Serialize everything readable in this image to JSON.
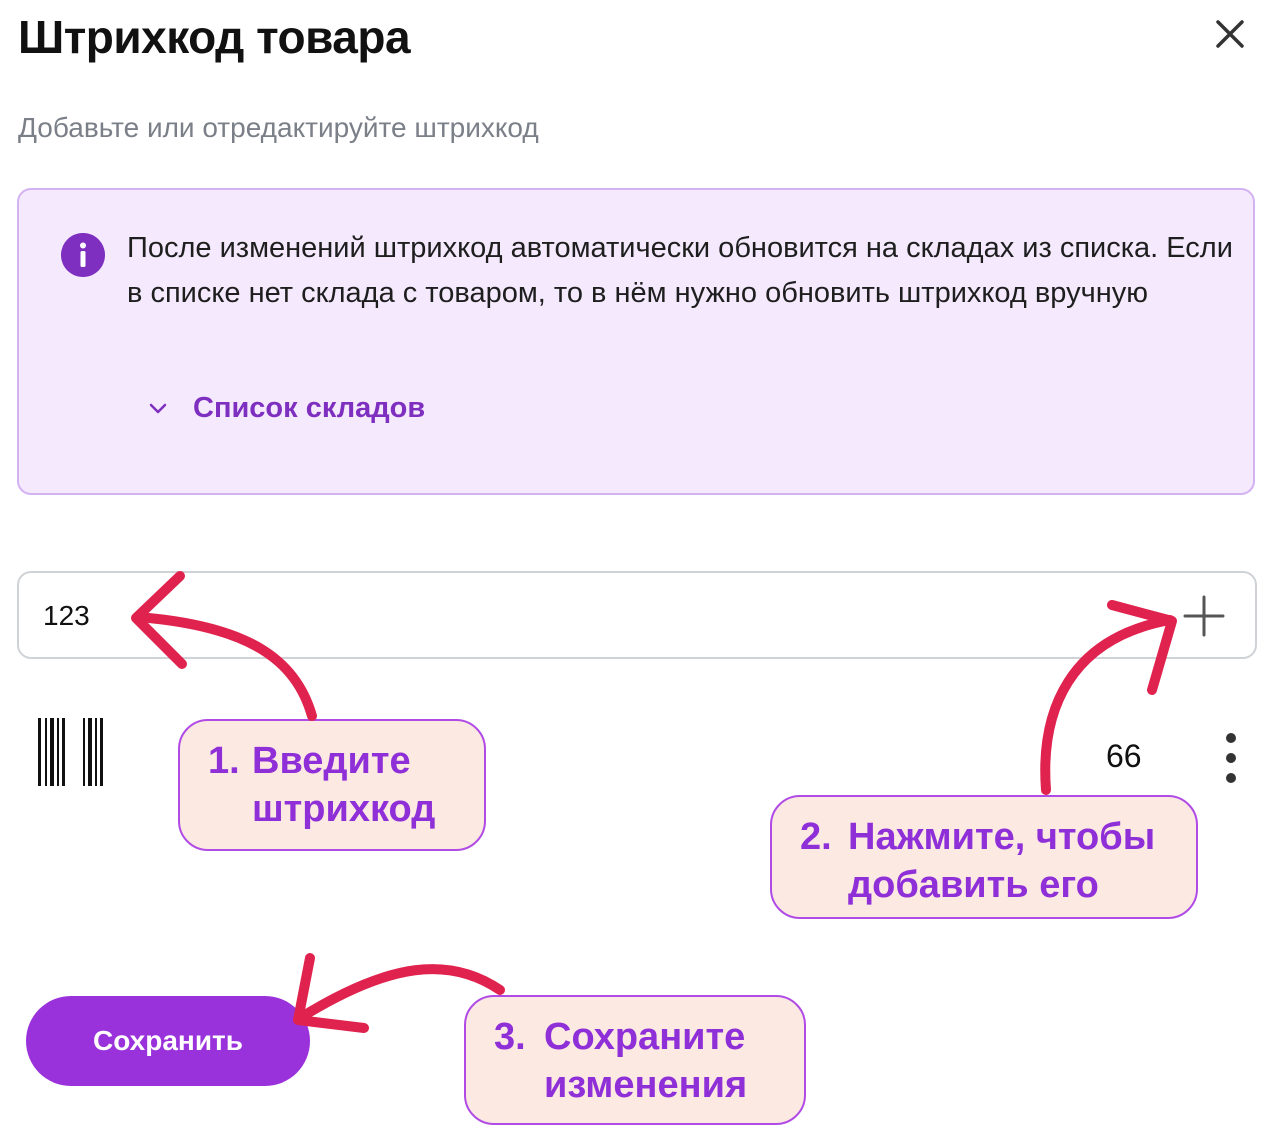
{
  "dialog": {
    "title": "Штрихкод товара",
    "subtitle": "Добавьте или отредактируйте штрихкод",
    "close_icon": "close-icon"
  },
  "info_banner": {
    "icon": "info-icon",
    "text": "После изменений штрихкод автоматически обновится на складах из списка. Если в списке нет склада с товаром, то в нём нужно обновить штрихкод вручную",
    "warehouses_toggle_label": "Список складов",
    "toggle_icon": "chevron-down-icon"
  },
  "barcode_input": {
    "value": "123",
    "add_icon": "plus-icon"
  },
  "barcode_list": [
    {
      "icon": "barcode-icon",
      "value": "66",
      "menu_icon": "more-vertical-icon"
    }
  ],
  "save_button_label": "Сохранить",
  "callouts": [
    {
      "number": "1.",
      "text_line1": "Введите",
      "text_line2": "штрихкод"
    },
    {
      "number": "2.",
      "text_line1": "Нажмите, чтобы",
      "text_line2": "добавить его"
    },
    {
      "number": "3.",
      "text_line1": "Сохраните",
      "text_line2": "изменения"
    }
  ],
  "colors": {
    "accent": "#9a32dc",
    "info_bg": "#f4e9fd",
    "callout_bg": "#fce9e2",
    "arrow": "#e0234e"
  }
}
